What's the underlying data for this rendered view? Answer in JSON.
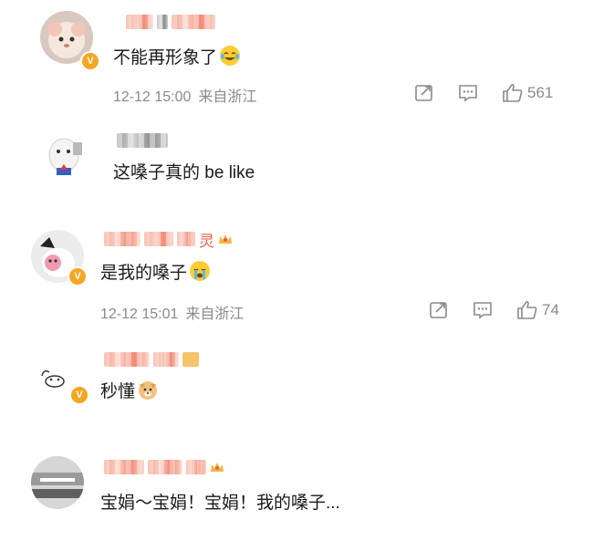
{
  "comments": [
    {
      "text": "不能再形象了",
      "emoji": "laughing-tears-emoji",
      "date": "12-12 15:00",
      "location": "来自浙江",
      "likes": "561",
      "verified_badge": "V"
    },
    {
      "text": "这嗓子真的 be like"
    },
    {
      "name_suffix": "灵",
      "text": "是我的嗓子",
      "emoji": "crying-emoji",
      "date": "12-12 15:01",
      "location": "来自浙江",
      "likes": "74",
      "verified_badge": "V"
    },
    {
      "text": "秒懂",
      "emoji": "doge-emoji",
      "verified_badge": "V"
    },
    {
      "text": "宝娟～宝娟！宝娟！我的嗓子..."
    }
  ],
  "icons": {
    "share": "share-icon",
    "comment": "comment-icon",
    "like": "thumbs-up-icon"
  },
  "colors": {
    "text": "#1a1a1a",
    "meta": "#8a8a8a",
    "badge": "#f5a623",
    "name_pink": "#e8604c"
  }
}
